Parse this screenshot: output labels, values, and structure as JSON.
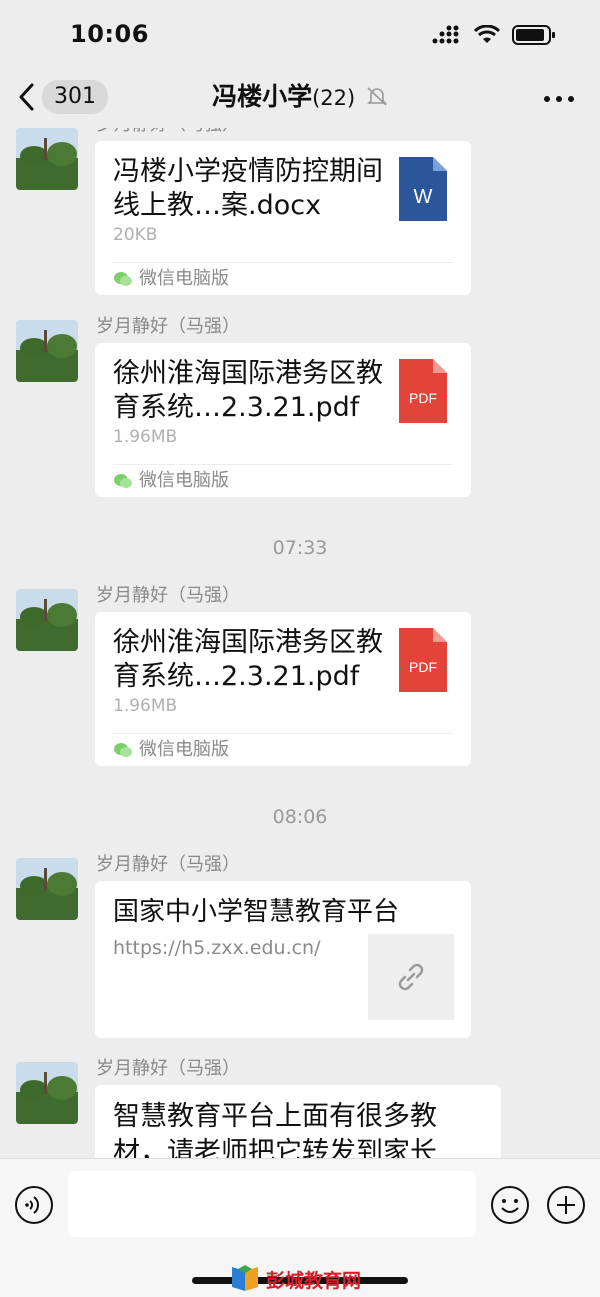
{
  "status_bar": {
    "time": "10:06"
  },
  "header": {
    "back_count": "301",
    "title": "冯楼小学",
    "member_count": "(22)"
  },
  "messages": [
    {
      "sender": "岁月静好（马强）",
      "file_name": "冯楼小学疫情防控期间线上教…案.docx",
      "file_size": "20KB",
      "file_type": "W",
      "source": "微信电脑版"
    },
    {
      "sender": "岁月静好（马强）",
      "file_name": "徐州淮海国际港务区教育系统…2.3.21.pdf",
      "file_size": "1.96MB",
      "file_type": "PDF",
      "source": "微信电脑版"
    },
    {
      "sender": "岁月静好（马强）",
      "file_name": "徐州淮海国际港务区教育系统…2.3.21.pdf",
      "file_size": "1.96MB",
      "file_type": "PDF",
      "source": "微信电脑版"
    },
    {
      "sender": "岁月静好（马强）",
      "link_title": "国家中小学智慧教育平台",
      "link_url": "https://h5.zxx.edu.cn/"
    },
    {
      "sender": "岁月静好（马强）",
      "text": " 智慧教育平台上面有很多教材，请老师把它转发到家长"
    }
  ],
  "time_separators": [
    "07:33",
    "08:06"
  ],
  "watermark": "彭城教育网",
  "colors": {
    "word_blue": "#2b579a",
    "pdf_red": "#e2433b",
    "background": "#ededed"
  }
}
